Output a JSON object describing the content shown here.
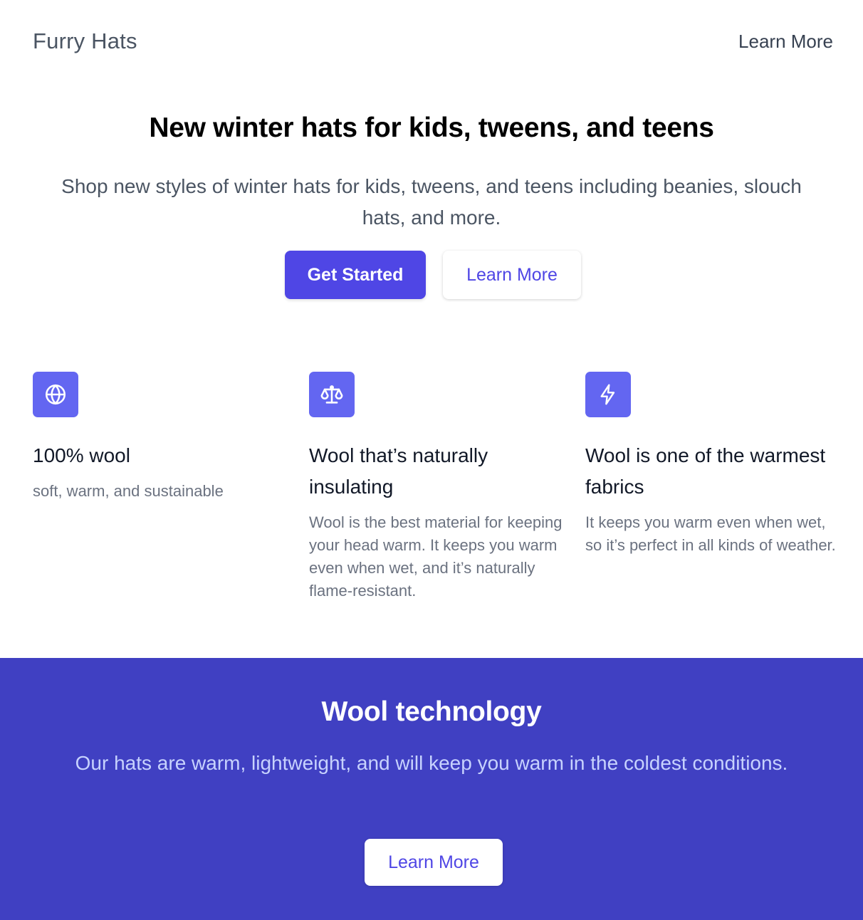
{
  "header": {
    "brand": "Furry Hats",
    "nav_link": "Learn More"
  },
  "hero": {
    "title": "New winter hats for kids, tweens, and teens",
    "subtitle": "Shop new styles of winter hats for kids, tweens, and teens including beanies, slouch hats, and more.",
    "primary_button": "Get Started",
    "secondary_button": "Learn More"
  },
  "features": [
    {
      "icon": "globe-icon",
      "title": "100% wool",
      "description": "soft, warm, and sustainable"
    },
    {
      "icon": "scale-icon",
      "title": "Wool that’s naturally insulating",
      "description": "Wool is the best material for keeping your head warm. It keeps you warm even when wet, and it’s naturally flame-resistant."
    },
    {
      "icon": "lightning-bolt-icon",
      "title": "Wool is one of the warmest fabrics",
      "description": "It keeps you warm even when wet, so it’s perfect in all kinds of weather."
    }
  ],
  "cta": {
    "title": "Wool technology",
    "text": "Our hats are warm, lightweight, and will keep you warm in the coldest conditions.",
    "button": "Learn More"
  },
  "colors": {
    "accent": "#4f46e5",
    "icon_bg": "#6366f1",
    "band_bg": "#4040c2"
  }
}
